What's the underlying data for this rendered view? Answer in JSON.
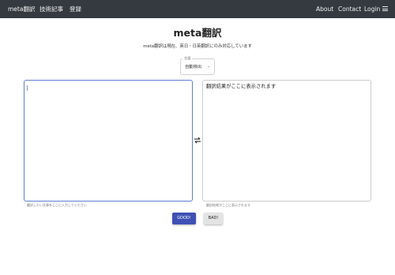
{
  "nav": {
    "brand": "meta翻訳",
    "articles": "技術記事",
    "register": "登録",
    "about": "About",
    "contact": "Contact",
    "login": "Login",
    "menu_icon": "hamburger-icon"
  },
  "main": {
    "title": "meta翻訳",
    "subtitle": "meta翻訳は現在、英日・日英翻訳にのみ対応しています"
  },
  "language_select": {
    "label": "言語",
    "value": "自動検出",
    "caret": "⌄"
  },
  "input": {
    "value": "",
    "helper": "翻訳したい文章をここに入力してください"
  },
  "output": {
    "placeholder": "翻訳結果がここに表示されます",
    "helper": "翻訳結果がここに表示されます"
  },
  "swap": {
    "icon": "swap-arrows-icon"
  },
  "buttons": {
    "good": "GOOD!",
    "bad": "BAD!"
  },
  "colors": {
    "navbar": "#343a40",
    "primary": "#3f51b5",
    "input_focus_border": "#5b7fcf"
  }
}
